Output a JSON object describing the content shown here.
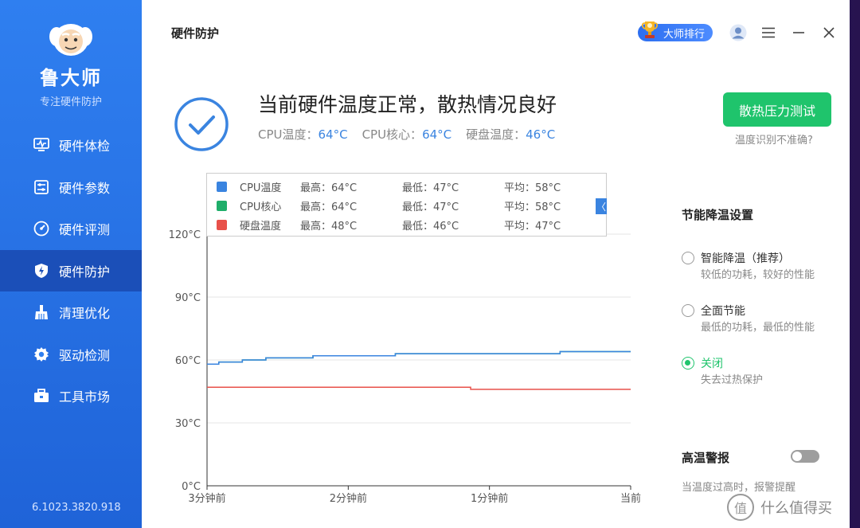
{
  "app": {
    "brand": "鲁大师",
    "slogan": "专注硬件防护",
    "version": "6.1023.3820.918"
  },
  "sidebar": {
    "items": [
      {
        "label": "硬件体检",
        "icon": "monitor-pulse-icon",
        "active": false
      },
      {
        "label": "硬件参数",
        "icon": "sliders-icon",
        "active": false
      },
      {
        "label": "硬件评测",
        "icon": "gauge-icon",
        "active": false
      },
      {
        "label": "硬件防护",
        "icon": "shield-bolt-icon",
        "active": true
      },
      {
        "label": "清理优化",
        "icon": "broom-icon",
        "active": false
      },
      {
        "label": "驱动检测",
        "icon": "gear-icon",
        "active": false
      },
      {
        "label": "工具市场",
        "icon": "toolbox-icon",
        "active": false
      }
    ]
  },
  "header": {
    "title": "硬件防护",
    "rank_label": "大师排行"
  },
  "status": {
    "headline": "当前硬件温度正常，散热情况良好",
    "cpu_temp_label": "CPU温度：",
    "cpu_temp_value": "64°C",
    "cpu_core_label": "CPU核心：",
    "cpu_core_value": "64°C",
    "disk_temp_label": "硬盘温度：",
    "disk_temp_value": "46°C",
    "stress_button": "散热压力测试",
    "temp_hint": "温度识别不准确?"
  },
  "legend": {
    "toggle": "〈",
    "rows": [
      {
        "name": "CPU温度",
        "max": "最高：64°C",
        "min": "最低：47°C",
        "avg": "平均：58°C",
        "color": "#3a84e0"
      },
      {
        "name": "CPU核心",
        "max": "最高：64°C",
        "min": "最低：47°C",
        "avg": "平均：58°C",
        "color": "#1fae6a"
      },
      {
        "name": "硬盘温度",
        "max": "最高：48°C",
        "min": "最低：46°C",
        "avg": "平均：47°C",
        "color": "#e8514a"
      }
    ]
  },
  "chart_data": {
    "type": "line",
    "title": "",
    "xlabel": "",
    "ylabel": "",
    "x_ticks": [
      "3分钟前",
      "2分钟前",
      "1分钟前",
      "当前"
    ],
    "y_ticks": [
      "120°C",
      "90°C",
      "60°C",
      "30°C",
      "0°C"
    ],
    "ylim": [
      0,
      120
    ],
    "xlim": [
      0,
      180
    ],
    "grid": true,
    "legend_position": "top",
    "series": [
      {
        "name": "CPU核心",
        "color": "#1fae6a",
        "x": [
          0,
          5,
          10,
          15,
          20,
          25,
          30,
          35,
          40,
          45,
          50,
          55,
          60,
          65,
          70,
          75,
          80,
          85,
          90,
          95,
          100,
          105,
          110,
          115,
          120,
          125,
          130,
          135,
          140,
          145,
          150,
          155,
          160,
          165,
          170,
          175,
          180
        ],
        "values": [
          58,
          59,
          59,
          60,
          60,
          61,
          61,
          61,
          61,
          62,
          62,
          62,
          62,
          62,
          62,
          62,
          63,
          63,
          63,
          63,
          63,
          63,
          63,
          63,
          63,
          63,
          63,
          63,
          63,
          63,
          64,
          64,
          64,
          64,
          64,
          64,
          64
        ]
      },
      {
        "name": "CPU温度",
        "color": "#3a84e0",
        "x": [
          0,
          5,
          10,
          15,
          20,
          25,
          30,
          35,
          40,
          45,
          50,
          55,
          60,
          65,
          70,
          75,
          80,
          85,
          90,
          95,
          100,
          105,
          110,
          115,
          120,
          125,
          130,
          135,
          140,
          145,
          150,
          155,
          160,
          165,
          170,
          175,
          180
        ],
        "values": [
          58,
          59,
          59,
          60,
          60,
          61,
          61,
          61,
          61,
          62,
          62,
          62,
          62,
          62,
          62,
          62,
          63,
          63,
          63,
          63,
          63,
          63,
          63,
          63,
          63,
          63,
          63,
          63,
          63,
          63,
          64,
          64,
          64,
          64,
          64,
          64,
          64
        ]
      },
      {
        "name": "硬盘温度",
        "color": "#e8514a",
        "x": [
          0,
          30,
          60,
          90,
          110,
          112,
          120,
          150,
          180
        ],
        "values": [
          47,
          47,
          47,
          47,
          47,
          46,
          46,
          46,
          46
        ]
      }
    ]
  },
  "settings": {
    "title": "节能降温设置",
    "options": [
      {
        "label": "智能降温（推荐）",
        "desc": "较低的功耗，较好的性能",
        "checked": false
      },
      {
        "label": "全面节能",
        "desc": "最低的功耗，最低的性能",
        "checked": false
      },
      {
        "label": "关闭",
        "desc": "失去过热保护",
        "checked": true
      }
    ],
    "alarm_title": "高温警报",
    "alarm_desc": "当温度过高时，报警提醒",
    "alarm_on": false
  },
  "watermark": {
    "glyph": "值",
    "text": "什么值得买"
  },
  "colors": {
    "sidebar": "#2f7ff0",
    "sidebar_active": "#1b4fb8",
    "accent_green": "#1fc46c",
    "accent_blue": "#3a84e0"
  }
}
